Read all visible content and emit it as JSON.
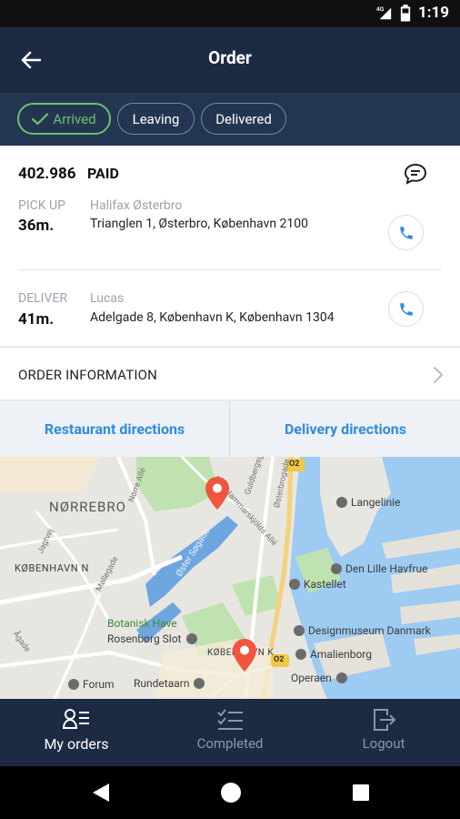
{
  "status_bar": {
    "network_label": "4G",
    "time": "1:19",
    "icons": [
      "signal-icon",
      "battery-icon"
    ]
  },
  "app_bar": {
    "title": "Order",
    "back_icon": "arrow-left-icon"
  },
  "order_status_tabs": [
    {
      "label": "Arrived",
      "active": true,
      "icon": "check-icon"
    },
    {
      "label": "Leaving",
      "active": false
    },
    {
      "label": "Delivered",
      "active": false
    }
  ],
  "order": {
    "number": "402.986",
    "payment_status": "PAID",
    "chat_icon": "chat-bubble-icon",
    "pickup": {
      "label": "PICK UP",
      "time": "36m.",
      "name": "Halifax Østerbro",
      "address": "Trianglen 1, Østerbro, København 2100",
      "call_icon": "phone-icon"
    },
    "delivery": {
      "label": "DELIVER",
      "time": "41m.",
      "name": "Lucas",
      "address": "Adelgade 8, København K, København 1304",
      "call_icon": "phone-icon"
    }
  },
  "order_information": {
    "label": "ORDER INFORMATION",
    "icon": "chevron-right-icon"
  },
  "directions": {
    "restaurant_label": "Restaurant directions",
    "delivery_label": "Delivery directions"
  },
  "map": {
    "labels": {
      "district_norrebro": "NØRREBRO",
      "district_kobenhavn_n": "KØBENHAVN N",
      "langelinie": "Langelinie",
      "den_lille_havfrue": "Den Lille Havfrue",
      "kastellet": "Kastellet",
      "designmuseum": "Designmuseum Danmark",
      "amalienborg": "Amalienborg",
      "operaen": "Operaen",
      "botanisk_have": "Botanisk Have",
      "rosenborg_slot": "Rosenborg Slot",
      "kobenhavn_k": "KØBENHAVN K",
      "rundetaarn": "Rundetaarn",
      "forum": "Forum",
      "oster_sogade": "Øster Søgade",
      "road_o2_top": "O2",
      "road_o2_bottom": "O2",
      "jagtvej": "Jagtvej",
      "mollegade": "Møllegade",
      "agade": "Ågade",
      "norre_alle": "Nørre Allé",
      "guldbergsgade": "Guldbergsgade",
      "osterbrogade": "Østerbrogade",
      "dag_hammarskjolds_alle": "Dag Hammarskjölds Allé"
    },
    "pins": [
      "map-pin-icon",
      "map-pin-icon"
    ],
    "pin_color": "#f1553f"
  },
  "bottom_nav": [
    {
      "label": "My orders",
      "icon": "orders-list-icon",
      "active": true
    },
    {
      "label": "Completed",
      "icon": "checklist-icon",
      "active": false
    },
    {
      "label": "Logout",
      "icon": "logout-icon",
      "active": false
    }
  ],
  "android_nav": [
    "back-triangle-icon",
    "home-circle-icon",
    "recents-square-icon"
  ],
  "colors": {
    "app_bar": "#1d2a44",
    "tab_bar": "#243552",
    "active_green": "#6ac26a",
    "link_blue": "#2f8ce0"
  }
}
